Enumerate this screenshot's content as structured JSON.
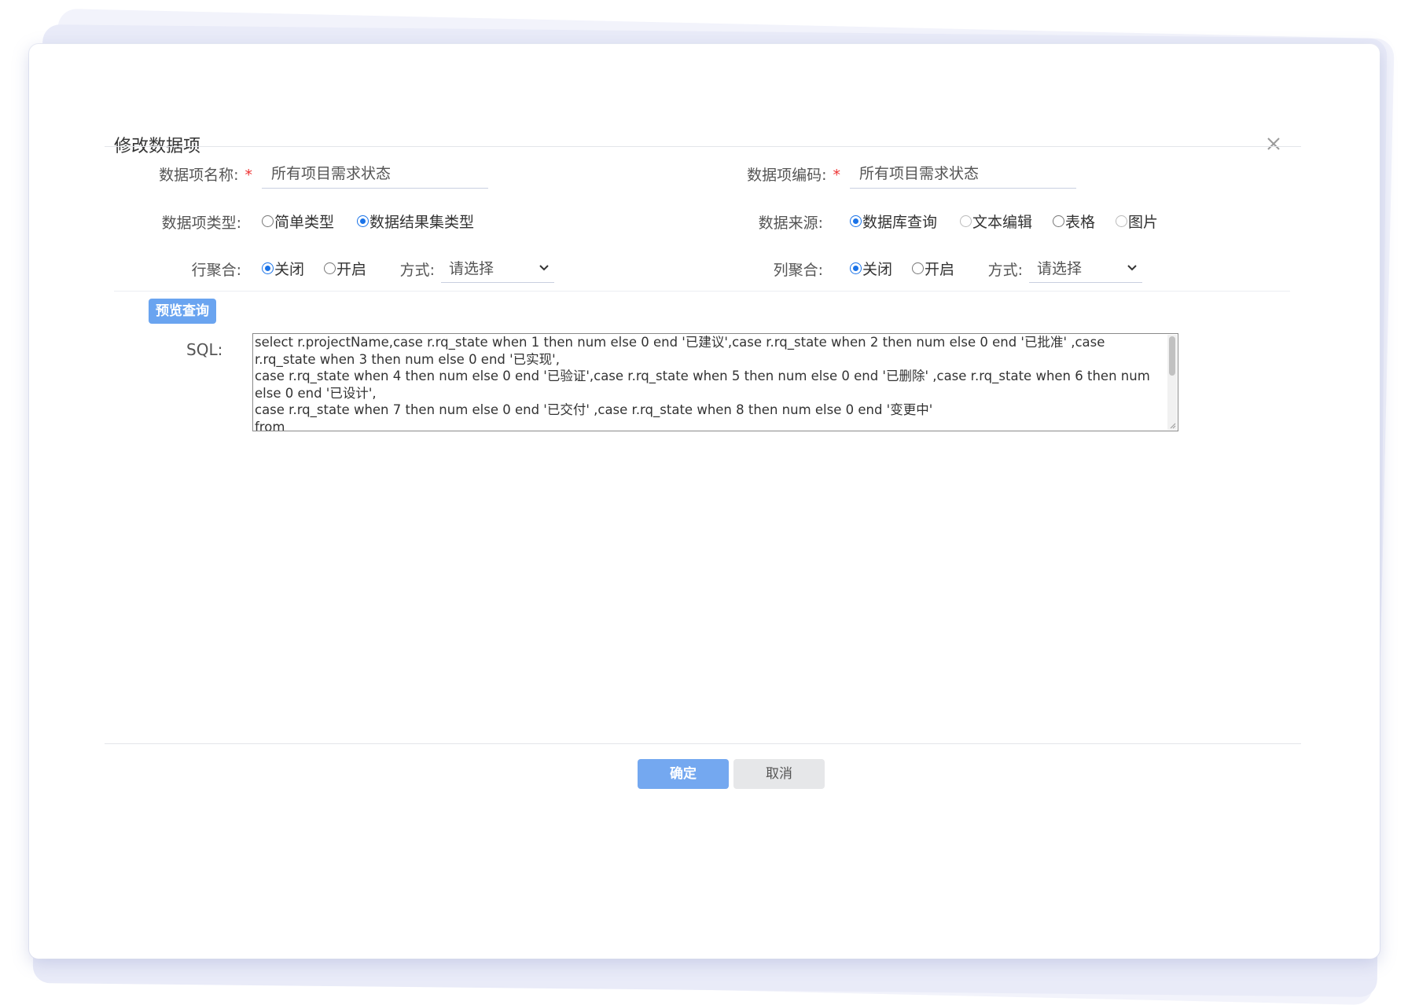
{
  "dialog": {
    "title": "修改数据项"
  },
  "form": {
    "item_name": {
      "label": "数据项名称:",
      "required_mark": "*",
      "value": "所有项目需求状态"
    },
    "item_code": {
      "label": "数据项编码:",
      "required_mark": "*",
      "value": "所有项目需求状态"
    },
    "item_type": {
      "label": "数据项类型:",
      "options": [
        {
          "label": "简单类型",
          "selected": false
        },
        {
          "label": "数据结果集类型",
          "selected": true
        }
      ]
    },
    "data_source": {
      "label": "数据来源:",
      "options": [
        {
          "label": "数据库查询",
          "selected": true
        },
        {
          "label": "文本编辑",
          "selected": false
        },
        {
          "label": "表格",
          "selected": false
        },
        {
          "label": "图片",
          "selected": false
        }
      ]
    },
    "row_aggregation": {
      "label": "行聚合:",
      "options": [
        {
          "label": "关闭",
          "selected": true
        },
        {
          "label": "开启",
          "selected": false
        }
      ],
      "mode_label": "方式:",
      "mode_value": "请选择"
    },
    "col_aggregation": {
      "label": "列聚合:",
      "options": [
        {
          "label": "关闭",
          "selected": true
        },
        {
          "label": "开启",
          "selected": false
        }
      ],
      "mode_label": "方式:",
      "mode_value": "请选择"
    }
  },
  "preview_button": "预览查询",
  "sql": {
    "label": "SQL:",
    "lines": [
      "select r.projectName,case r.rq_state when 1 then num else 0 end  '已建议',case r.rq_state when 2 then num  else 0 end  '已批准' ,case",
      "r.rq_state when 3 then num else 0 end  '已实现',",
      "case r.rq_state when 4 then num else 0 end  '已验证',case r.rq_state when 5 then num else 0 end  '已删除' ,case r.rq_state when 6 then num",
      "else 0 end  '已设计',",
      "case r.rq_state when 7 then num else 0 end  '已交付' ,case r.rq_state when 8 then num else 0 end  '变更中'",
      "from"
    ]
  },
  "footer": {
    "ok": "确定",
    "cancel": "取消"
  },
  "colors": {
    "primary": "#6aa4f0",
    "radio_selected": "#1a73e8",
    "required": "#e33333"
  }
}
